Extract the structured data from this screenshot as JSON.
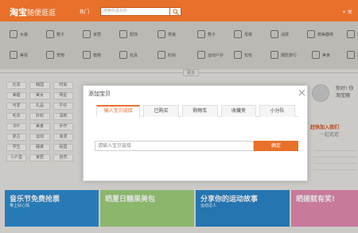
{
  "header": {
    "logo_main": "淘宝",
    "logo_sub": "随便逛逛",
    "hot_label": "热门",
    "search_placeholder": "搜索你喜欢的",
    "follow_label": "+ 关"
  },
  "categories": [
    "女装",
    "鞋子",
    "家居",
    "配饰",
    "男装",
    "鞋子",
    "母婴",
    "消费",
    "赠美趣味",
    "玩",
    "美妆",
    "宠物",
    "植物",
    "玩具",
    "时尚",
    "运动户外",
    "包包",
    "摄影旅行",
    "美食",
    "数"
  ],
  "more_label": "更多",
  "tags": [
    "化妆",
    "韩国",
    "时尚",
    "美甜",
    "美女",
    "明星",
    "可爱",
    "礼品",
    "牛仔",
    "毛衣",
    "针织",
    "清新",
    "DIY",
    "美食",
    "手作",
    "复古",
    "运动",
    "浪漫",
    "学生",
    "睡裤",
    "民国",
    "小户型",
    "家居",
    "自然"
  ],
  "right_panel": {
    "greeting": "你好! 你",
    "brand": "淘宝随",
    "cta_line1": "赶快加入我们",
    "cta_line2": "一起逛逛"
  },
  "banners": [
    {
      "title": "音乐节免费抢票",
      "sub": "带上好心情"
    },
    {
      "title": "晒夏日糖果美包",
      "sub": ""
    },
    {
      "title": "分享你的运动故事",
      "sub": "运动达人"
    },
    {
      "title": "晒搓就有奖!",
      "sub": ""
    }
  ],
  "dialog": {
    "title": "添加宝贝",
    "tabs": [
      "输入宝贝链接",
      "已购买",
      "购物车",
      "收藏夹",
      "小分队"
    ],
    "input_placeholder": "请输入宝贝链接",
    "confirm_label": "确定"
  },
  "colors": {
    "brand_orange": "#e8702a"
  }
}
